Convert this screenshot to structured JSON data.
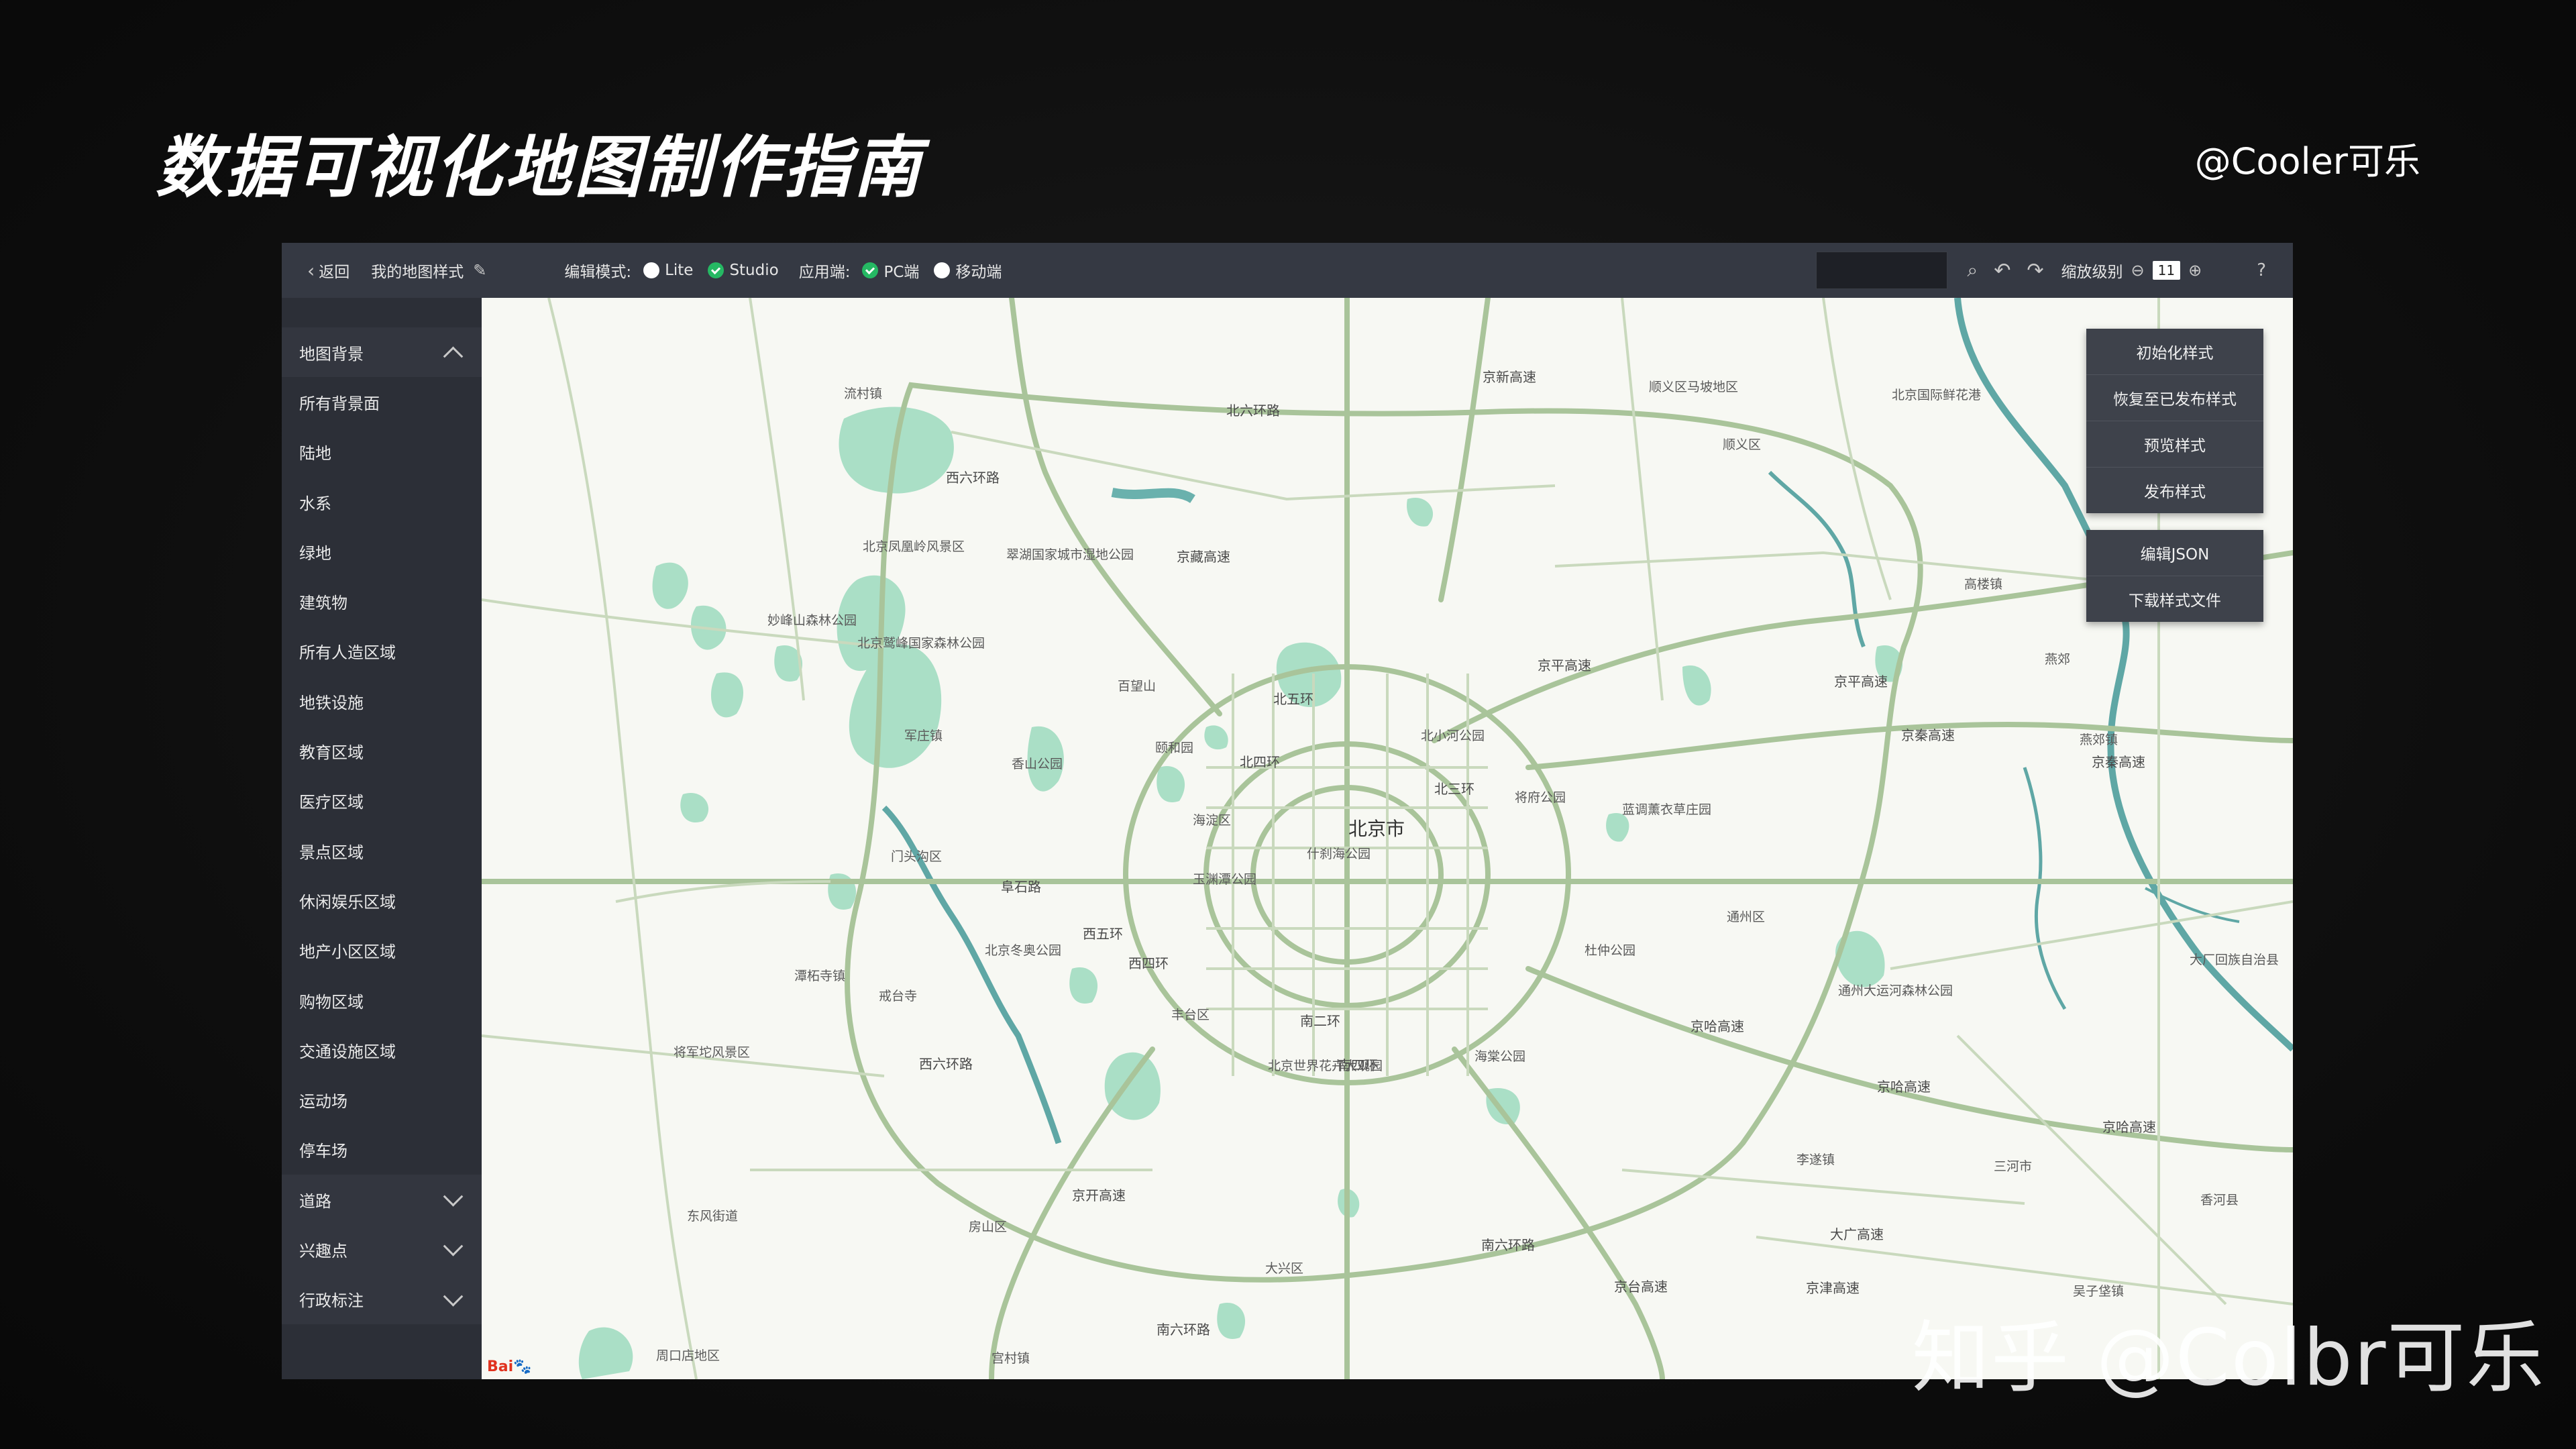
{
  "slide": {
    "title": "数据可视化地图制作指南",
    "author": "@Cooler可乐",
    "watermark": "知乎 @Colbr可乐"
  },
  "topbar": {
    "back_label": "返回",
    "style_name": "我的地图样式",
    "edit_mode_label": "编辑模式:",
    "mode_lite": "Lite",
    "mode_studio": "Studio",
    "platform_label": "应用端:",
    "platform_pc": "PC端",
    "platform_mobile": "移动端",
    "search_value": "",
    "zoom_label": "缩放级别",
    "zoom_value": "11"
  },
  "sidebar": {
    "section_background": "地图背景",
    "items": [
      "所有背景面",
      "陆地",
      "水系",
      "绿地",
      "建筑物",
      "所有人造区域",
      "地铁设施",
      "教育区域",
      "医疗区域",
      "景点区域",
      "休闲娱乐区域",
      "地产小区区域",
      "购物区域",
      "交通设施区域",
      "运动场",
      "停车场"
    ],
    "section_road": "道路",
    "section_poi": "兴趣点",
    "section_admin": "行政标注"
  },
  "panel_top": [
    "初始化样式",
    "恢复至已发布样式",
    "预览样式",
    "发布样式"
  ],
  "panel_bottom": [
    "编辑JSON",
    "下载样式文件"
  ],
  "map_labels": {
    "city": "北京市",
    "r6n": "北六环路",
    "r5": "北五环",
    "r4": "北四环",
    "r3": "北三环",
    "s2": "南二环",
    "s4": "南四环",
    "s6": "南六环路",
    "se6": "南六环路",
    "jingping": "京平高速",
    "jingping2": "京平高速",
    "jingqin": "京秦高速",
    "jingqin2": "京秦高速",
    "jingha": "京哈高速",
    "jingha2": "京哈高速",
    "jingha3": "京哈高速",
    "fushi": "阜石路",
    "w5": "西五环",
    "w4": "西四环",
    "w6": "西六环路",
    "w6b": "西六环路",
    "jingzang": "京藏高速",
    "jingkai": "京开高速",
    "jingtai": "京台高速",
    "jingxin": "京新高速",
    "jingjin": "京津高速",
    "jingcheng": "大广高速",
    "liucun": "流村镇",
    "shunyi": "顺义区",
    "shunyi_town": "顺义区马坡地区",
    "flower": "北京国际鲜花港",
    "fenghuangling": "北京凤凰岭风景区",
    "cuihu": "翠湖国家城市湿地公园",
    "miaofeng": "妙峰山森林公园",
    "jiulong": "北京鹫峰国家森林公园",
    "baiwang": "百望山",
    "yiheyuan": "颐和园",
    "xiangshan": "香山公园",
    "haidian": "海淀区",
    "shichahai": "什刹海公园",
    "yuyuantan": "玉渊潭公园",
    "beixiaohe": "北小河公园",
    "jiangfu": "将府公园",
    "chaoyang": "蓝调薰衣草庄园",
    "tongzhou": "通州区",
    "tongzhoucanal": "通州大运河森林公园",
    "dachang": "大厂回族自治县",
    "mentougou": "门头沟区",
    "junzhuang": "军庄镇",
    "tanzhe": "潭柘寺镇",
    "jietai": "戒台寺",
    "beijingwinter": "北京冬奥公园",
    "fengtai": "丰台区",
    "jiangjuntuo": "将军坨风景区",
    "beijingworld": "北京世界花卉大观园",
    "haitang": "海棠公园",
    "fangshan": "房山区",
    "dongfeng": "东风街道",
    "daxing": "大兴区",
    "zhouko": "周口店地区",
    "gongcheng": "宫村镇",
    "dujia": "杜仲公园",
    "yangzhuang": "燕郊镇",
    "sanhe": "三河市",
    "xianghe": "香河县",
    "yanjiao": "高楼镇",
    "wujiao": "燕郊",
    "guanzhuang": "吴子垡镇",
    "lichao": "李遂镇"
  },
  "colors": {
    "map_bg": "#f7f8f3",
    "road": "#a9c49a",
    "road_minor": "#c9d9bd",
    "water": "#5fa7a5",
    "green": "#aadfc6"
  }
}
